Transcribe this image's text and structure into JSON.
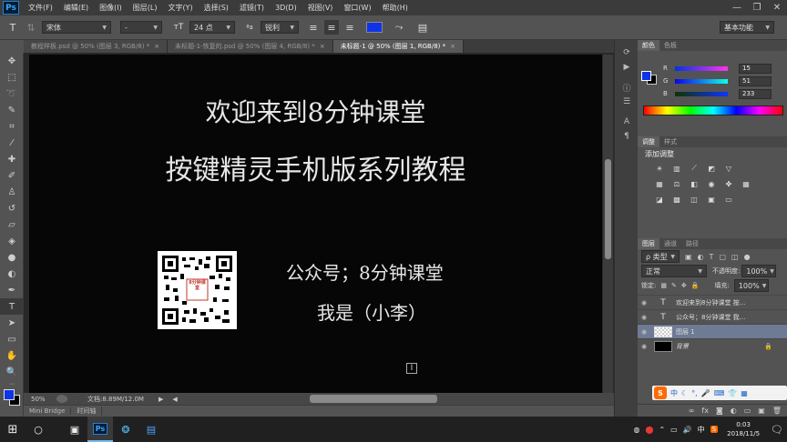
{
  "app": {
    "logo": "Ps"
  },
  "menu": [
    "文件(F)",
    "编辑(E)",
    "图像(I)",
    "图层(L)",
    "文字(Y)",
    "选择(S)",
    "滤镜(T)",
    "3D(D)",
    "视图(V)",
    "窗口(W)",
    "帮助(H)"
  ],
  "options": {
    "font_family": "宋体",
    "font_style": "-",
    "font_size": "24 点",
    "aa_label": "ªa",
    "anti_alias": "锐利",
    "text_color": "#0f33e9",
    "workspace": "基本功能"
  },
  "doc_tabs": [
    {
      "label": "教程样板.psd @ 50% (图层 3, RGB/8) *"
    },
    {
      "label": "未标题-1-恢复的.psd @ 50% (图层 4, RGB/8) *"
    },
    {
      "label": "未标题-1 @ 50% (图层 1, RGB/8) *"
    }
  ],
  "canvas": {
    "line1": "欢迎来到8分钟课堂",
    "line2": "按键精灵手机版系列教程",
    "line3": "公众号；8分钟课堂",
    "line4": "我是（小李）",
    "qr_label": "8分钟课堂"
  },
  "status": {
    "zoom": "50%",
    "doc_size": "文档:8.89M/12.0M"
  },
  "bottom_tabs": [
    "Mini Bridge",
    "时间轴"
  ],
  "color_panel": {
    "tabs": [
      "颜色",
      "色板"
    ],
    "r_label": "R",
    "g_label": "G",
    "b_label": "B",
    "r": "15",
    "g": "51",
    "b": "233",
    "foreground": "#0f33e9"
  },
  "adjust_panel": {
    "tabs": [
      "调整",
      "样式"
    ],
    "title": "添加调整"
  },
  "layers_panel": {
    "tabs": [
      "图层",
      "通道",
      "路径"
    ],
    "filter": "ρ 类型",
    "blend": "正常",
    "opacity_label": "不透明度:",
    "opacity": "100%",
    "lock_label": "锁定:",
    "fill_label": "填充:",
    "fill": "100%",
    "layers": [
      {
        "name": "欢迎来到8分钟课堂 按...",
        "type": "T"
      },
      {
        "name": "公众号；8分钟课堂 我...",
        "type": "T"
      },
      {
        "name": "图层 1",
        "type": "pixel"
      },
      {
        "name": "背景",
        "type": "bg"
      }
    ]
  },
  "ime": {
    "logo": "S",
    "mode": "中"
  },
  "taskbar": {
    "time": "0:03",
    "date": "2018/11/5",
    "lang": "中"
  }
}
